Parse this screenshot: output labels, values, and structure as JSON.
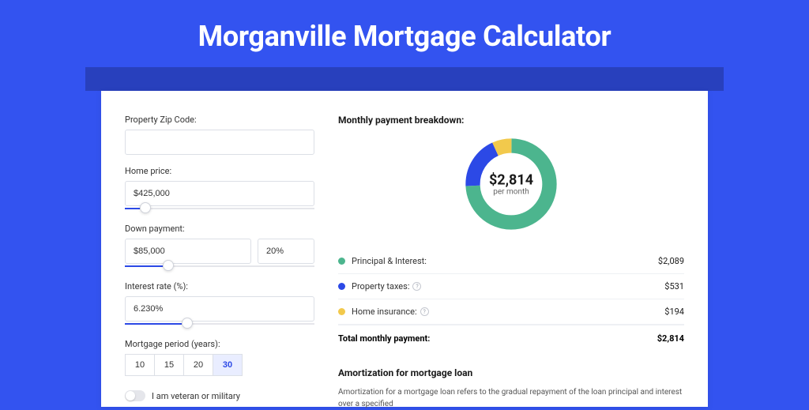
{
  "page_title": "Morganville Mortgage Calculator",
  "form": {
    "zip": {
      "label": "Property Zip Code:",
      "value": ""
    },
    "home_price": {
      "label": "Home price:",
      "value": "$425,000",
      "slider_pct": 8
    },
    "down_payment": {
      "label": "Down payment:",
      "value": "$85,000",
      "pct": "20%",
      "slider_pct": 20
    },
    "interest_rate": {
      "label": "Interest rate (%):",
      "value": "6.230%",
      "slider_pct": 30
    },
    "period": {
      "label": "Mortgage period (years):",
      "options": [
        "10",
        "15",
        "20",
        "30"
      ],
      "selected": "30"
    },
    "veteran_toggle": {
      "label": "I am veteran or military",
      "on": false
    }
  },
  "breakdown": {
    "title": "Monthly payment breakdown:",
    "donut": {
      "value": "$2,814",
      "subtitle": "per month"
    },
    "items": [
      {
        "color": "#4cb58e",
        "label": "Principal & Interest:",
        "value": "$2,089",
        "hint": false
      },
      {
        "color": "#2c49e6",
        "label": "Property taxes:",
        "value": "$531",
        "hint": true
      },
      {
        "color": "#f2c94c",
        "label": "Home insurance:",
        "value": "$194",
        "hint": true
      }
    ],
    "total": {
      "label": "Total monthly payment:",
      "value": "$2,814"
    }
  },
  "amort": {
    "title": "Amortization for mortgage loan",
    "text": "Amortization for a mortgage loan refers to the gradual repayment of the loan principal and interest over a specified"
  },
  "chart_data": {
    "type": "pie",
    "title": "Monthly payment breakdown",
    "series": [
      {
        "name": "Principal & Interest",
        "value": 2089,
        "color": "#4cb58e"
      },
      {
        "name": "Property taxes",
        "value": 531,
        "color": "#2c49e6"
      },
      {
        "name": "Home insurance",
        "value": 194,
        "color": "#f2c94c"
      }
    ],
    "total": 2814,
    "center_label": "$2,814 per month"
  }
}
